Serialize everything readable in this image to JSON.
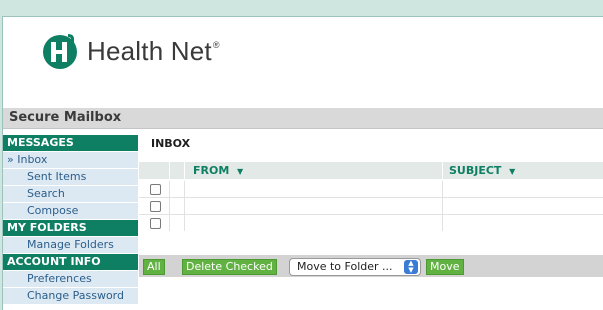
{
  "brand": {
    "name": "Health Net",
    "reg_mark": "®",
    "mark_letter": "H",
    "mark_sup": "n"
  },
  "page_title": "Secure Mailbox",
  "sidebar": {
    "sections": [
      {
        "heading": "MESSAGES",
        "items": [
          {
            "label": "» Inbox",
            "active": true
          },
          {
            "label": "Sent Items"
          },
          {
            "label": "Search"
          },
          {
            "label": "Compose"
          }
        ]
      },
      {
        "heading": "MY FOLDERS",
        "items": [
          {
            "label": "Manage Folders"
          }
        ]
      },
      {
        "heading": "ACCOUNT INFO",
        "items": [
          {
            "label": "Preferences"
          },
          {
            "label": "Change Password"
          }
        ]
      }
    ]
  },
  "main": {
    "title": "INBOX",
    "columns": {
      "from": "FROM",
      "subject": "SUBJECT",
      "sort_glyph": "▼"
    },
    "row_count": 3
  },
  "actions": {
    "all": "All",
    "delete_checked": "Delete Checked",
    "move_select": "Move to Folder ...",
    "move": "Move"
  },
  "colors": {
    "brand_green": "#0e7f62",
    "button_green": "#62b243",
    "link_blue": "#2a5e8c",
    "sidebar_bg": "#dde9f2"
  }
}
